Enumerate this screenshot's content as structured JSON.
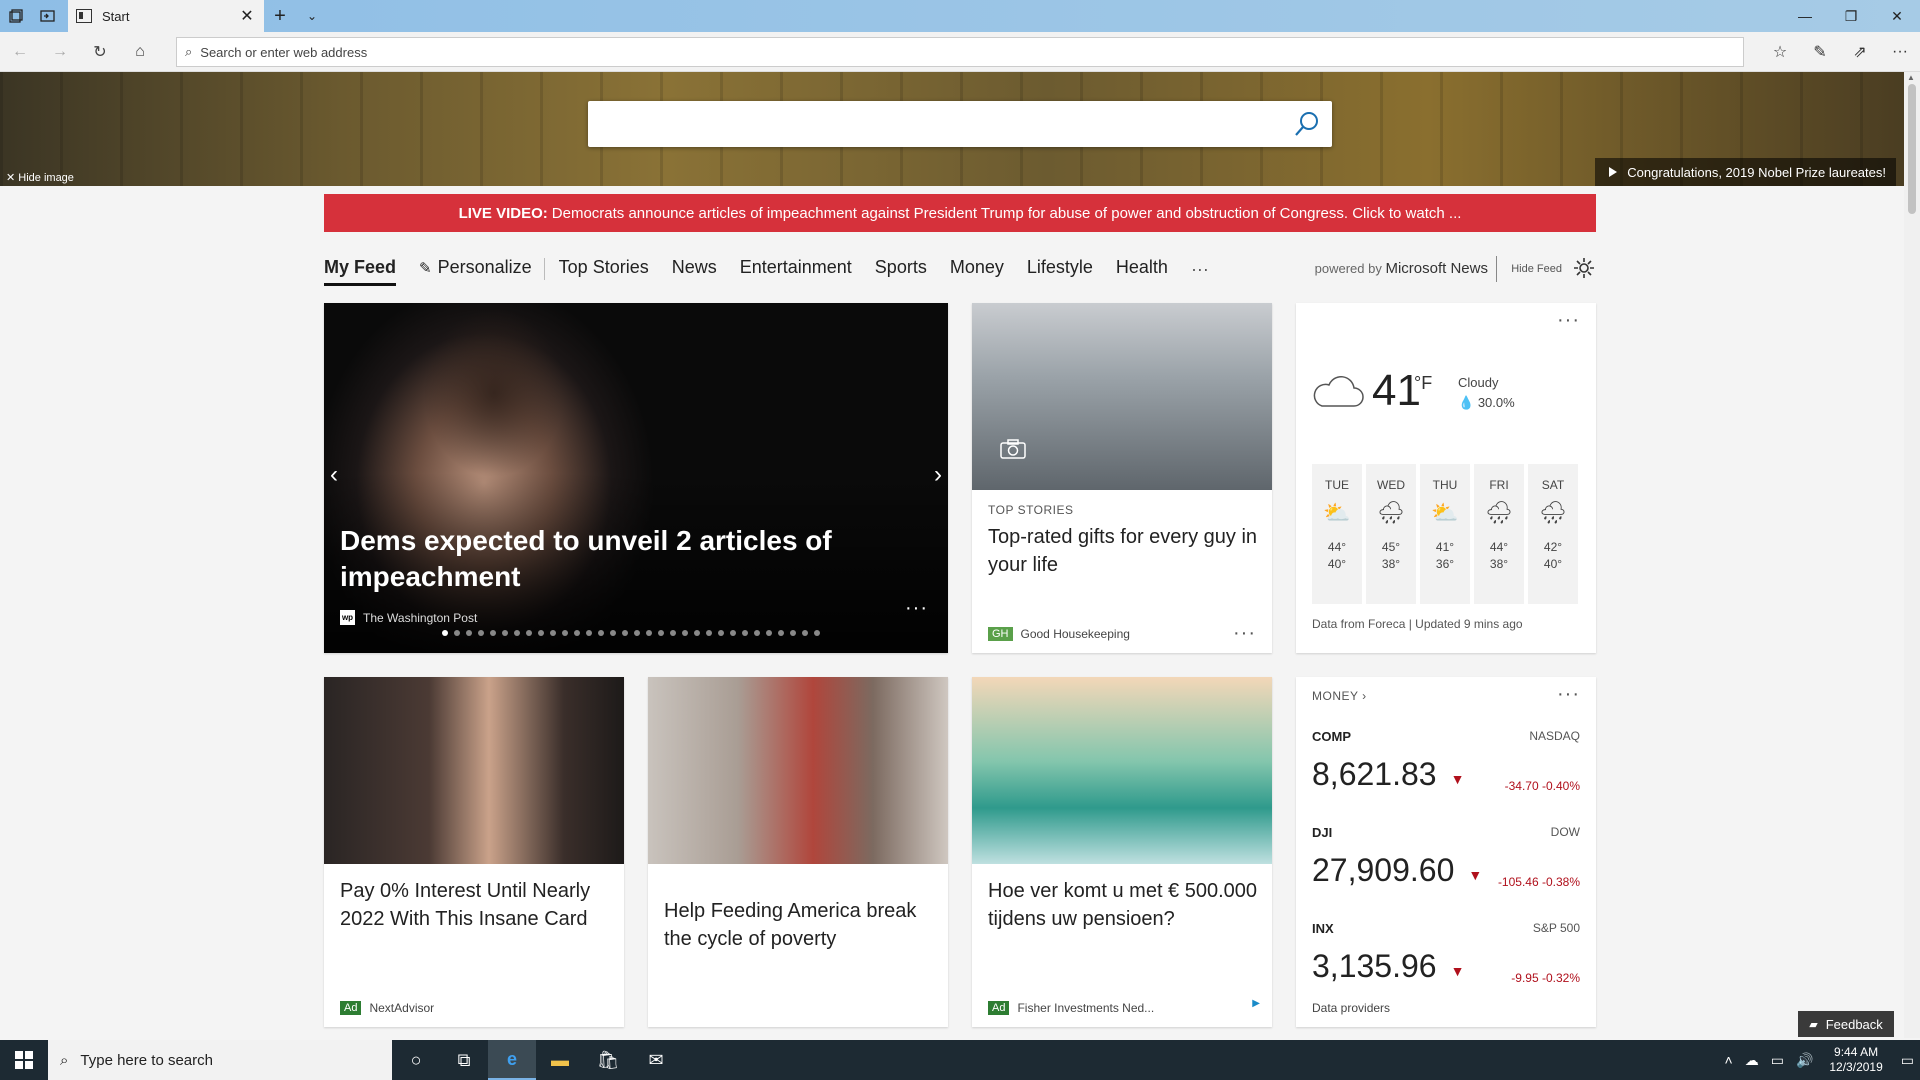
{
  "browser": {
    "tab_title": "Start",
    "address_placeholder": "Search or enter web address"
  },
  "hero": {
    "hide_image": "Hide image",
    "caption": "Congratulations, 2019 Nobel Prize laureates!"
  },
  "live": {
    "label": "LIVE VIDEO:",
    "text": "Democrats announce articles of impeachment against President Trump for abuse of power and obstruction of Congress. Click to watch ..."
  },
  "feed_nav": {
    "active": "My Feed",
    "personalize": "Personalize",
    "items": [
      "Top Stories",
      "News",
      "Entertainment",
      "Sports",
      "Money",
      "Lifestyle",
      "Health"
    ],
    "more": "···",
    "powered_by": "powered by",
    "brand": "Microsoft News",
    "hide_feed": "Hide Feed"
  },
  "main_story": {
    "headline": "Dems expected to unveil 2 articles of impeachment",
    "source": "The Washington Post",
    "source_logo": "wp"
  },
  "gifts_card": {
    "kicker": "TOP STORIES",
    "title": "Top-rated gifts for every guy in your life",
    "source": "Good Housekeeping",
    "source_badge": "GH"
  },
  "weather": {
    "temp": "41",
    "unit": "°F",
    "condition": "Cloudy",
    "precip": "30.0%",
    "days": [
      {
        "name": "TUE",
        "icon": "sun-cloud",
        "hi": "44°",
        "lo": "40°"
      },
      {
        "name": "WED",
        "icon": "rain-cloud",
        "hi": "45°",
        "lo": "38°"
      },
      {
        "name": "THU",
        "icon": "sun-cloud",
        "hi": "41°",
        "lo": "36°"
      },
      {
        "name": "FRI",
        "icon": "rain-cloud",
        "hi": "44°",
        "lo": "38°"
      },
      {
        "name": "SAT",
        "icon": "rain-cloud",
        "hi": "42°",
        "lo": "40°"
      }
    ],
    "credit": "Data from Foreca | Updated 9 mins ago"
  },
  "cards": [
    {
      "title": "Pay 0% Interest Until Nearly 2022 With This Insane Card",
      "badge": "Ad",
      "source": "NextAdvisor"
    },
    {
      "title": "Help Feeding America break the cycle of poverty"
    },
    {
      "title": "Hoe ver komt u met € 500.000 tijdens uw pensioen?",
      "badge": "Ad",
      "source": "Fisher Investments Ned..."
    }
  ],
  "money": {
    "header": "MONEY",
    "stocks": [
      {
        "symbol": "COMP",
        "exchange": "NASDAQ",
        "value": "8,621.83",
        "change": "-34.70 -0.40%"
      },
      {
        "symbol": "DJI",
        "exchange": "DOW",
        "value": "27,909.60",
        "change": "-105.46 -0.38%"
      },
      {
        "symbol": "INX",
        "exchange": "S&P 500",
        "value": "3,135.96",
        "change": "-9.95 -0.32%"
      }
    ],
    "providers": "Data providers"
  },
  "feedback": "Feedback",
  "taskbar": {
    "search_placeholder": "Type here to search",
    "time": "9:44 AM",
    "date": "12/3/2019"
  },
  "colors": {
    "live_banner": "#d6313b",
    "stock_down": "#b0101c",
    "taskbar": "#1d2a33"
  }
}
